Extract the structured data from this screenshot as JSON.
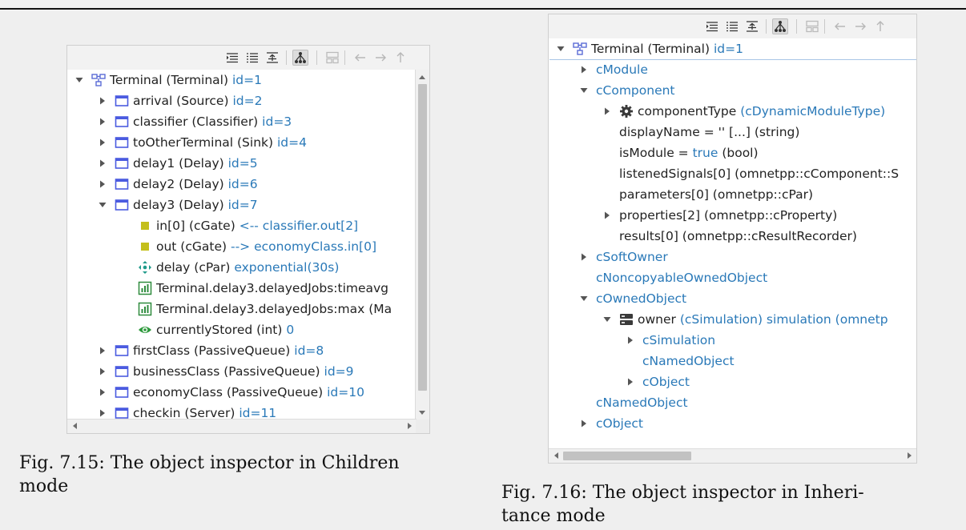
{
  "left": {
    "rows": [
      {
        "label": "Terminal (Terminal)",
        "extra": "id=1",
        "twisty": "open",
        "icon": "module-tree-icon",
        "depth": 0
      },
      {
        "label": "arrival (Source)",
        "extra": "id=2",
        "twisty": "closed",
        "icon": "module-icon",
        "depth": 1
      },
      {
        "label": "classifier (Classifier)",
        "extra": "id=3",
        "twisty": "closed",
        "icon": "module-icon",
        "depth": 1
      },
      {
        "label": "toOtherTerminal (Sink)",
        "extra": "id=4",
        "twisty": "closed",
        "icon": "module-icon",
        "depth": 1
      },
      {
        "label": "delay1 (Delay)",
        "extra": "id=5",
        "twisty": "closed",
        "icon": "module-icon",
        "depth": 1
      },
      {
        "label": "delay2 (Delay)",
        "extra": "id=6",
        "twisty": "closed",
        "icon": "module-icon",
        "depth": 1
      },
      {
        "label": "delay3 (Delay)",
        "extra": "id=7",
        "twisty": "open",
        "icon": "module-icon",
        "depth": 1
      },
      {
        "label": "in[0] (cGate)",
        "extra": "<-- classifier.out[2]",
        "twisty": "none",
        "icon": "gate-icon",
        "depth": 2
      },
      {
        "label": "out (cGate)",
        "extra": "--> economyClass.in[0]",
        "twisty": "none",
        "icon": "gate-icon",
        "depth": 2
      },
      {
        "label": "delay (cPar)",
        "extra": "exponential(30s)",
        "twisty": "none",
        "icon": "parameter-icon",
        "depth": 2
      },
      {
        "label": "Terminal.delay3.delayedJobs:timeavg",
        "extra": "",
        "twisty": "none",
        "icon": "statistic-icon",
        "depth": 2
      },
      {
        "label": "Terminal.delay3.delayedJobs:max (Ma",
        "extra": "",
        "twisty": "none",
        "icon": "statistic-icon",
        "depth": 2
      },
      {
        "label": "currentlyStored (int)",
        "extra": "0",
        "twisty": "none",
        "icon": "watch-icon",
        "depth": 2
      },
      {
        "label": "firstClass (PassiveQueue)",
        "extra": "id=8",
        "twisty": "closed",
        "icon": "module-icon",
        "depth": 1
      },
      {
        "label": "businessClass (PassiveQueue)",
        "extra": "id=9",
        "twisty": "closed",
        "icon": "module-icon",
        "depth": 1
      },
      {
        "label": "economyClass (PassiveQueue)",
        "extra": "id=10",
        "twisty": "closed",
        "icon": "module-icon",
        "depth": 1
      },
      {
        "label": "checkin (Server)",
        "extra": "id=11",
        "twisty": "closed",
        "icon": "module-icon",
        "depth": 1
      }
    ],
    "caption_lines": [
      "Fig. 7.15: The object inspector in Children",
      "mode"
    ]
  },
  "right": {
    "rows": [
      {
        "parts": [
          {
            "t": "Terminal (Terminal) ",
            "c": "k"
          },
          {
            "t": "id=1",
            "c": "b"
          }
        ],
        "twisty": "open",
        "icon": "module-tree-icon",
        "depth": 0
      },
      {
        "parts": [
          {
            "t": "cModule",
            "c": "b"
          }
        ],
        "twisty": "closed",
        "icon": "",
        "depth": 1
      },
      {
        "parts": [
          {
            "t": "cComponent",
            "c": "b"
          }
        ],
        "twisty": "open",
        "icon": "",
        "depth": 1
      },
      {
        "parts": [
          {
            "t": "componentType ",
            "c": "k"
          },
          {
            "t": "(cDynamicModuleType)",
            "c": "b"
          }
        ],
        "twisty": "closed",
        "icon": "gear-icon",
        "depth": 2
      },
      {
        "parts": [
          {
            "t": "displayName = '' [...]  (string)",
            "c": "k"
          }
        ],
        "twisty": "none",
        "icon": "",
        "depth": 2
      },
      {
        "parts": [
          {
            "t": "isModule = ",
            "c": "k"
          },
          {
            "t": "true",
            "c": "b"
          },
          {
            "t": " (bool)",
            "c": "k"
          }
        ],
        "twisty": "none",
        "icon": "",
        "depth": 2
      },
      {
        "parts": [
          {
            "t": "listenedSignals[0] (omnetpp::cComponent::S",
            "c": "k"
          }
        ],
        "twisty": "none",
        "icon": "",
        "depth": 2
      },
      {
        "parts": [
          {
            "t": "parameters[0] (omnetpp::cPar)",
            "c": "k"
          }
        ],
        "twisty": "none",
        "icon": "",
        "depth": 2
      },
      {
        "parts": [
          {
            "t": "properties[2] (omnetpp::cProperty)",
            "c": "k"
          }
        ],
        "twisty": "closed",
        "icon": "",
        "depth": 2
      },
      {
        "parts": [
          {
            "t": "results[0] (omnetpp::cResultRecorder)",
            "c": "k"
          }
        ],
        "twisty": "none",
        "icon": "",
        "depth": 2
      },
      {
        "parts": [
          {
            "t": "cSoftOwner",
            "c": "b"
          }
        ],
        "twisty": "closed",
        "icon": "",
        "depth": 1
      },
      {
        "parts": [
          {
            "t": "cNoncopyableOwnedObject",
            "c": "b"
          }
        ],
        "twisty": "none",
        "icon": "",
        "depth": 1
      },
      {
        "parts": [
          {
            "t": "cOwnedObject",
            "c": "b"
          }
        ],
        "twisty": "open",
        "icon": "",
        "depth": 1
      },
      {
        "parts": [
          {
            "t": "owner ",
            "c": "k"
          },
          {
            "t": "(cSimulation) simulation (omnetp",
            "c": "b"
          }
        ],
        "twisty": "open",
        "icon": "simulation-icon",
        "depth": 2
      },
      {
        "parts": [
          {
            "t": "cSimulation",
            "c": "b"
          }
        ],
        "twisty": "closed",
        "icon": "",
        "depth": 3
      },
      {
        "parts": [
          {
            "t": "cNamedObject",
            "c": "b"
          }
        ],
        "twisty": "none",
        "icon": "",
        "depth": 3
      },
      {
        "parts": [
          {
            "t": "cObject",
            "c": "b"
          }
        ],
        "twisty": "closed",
        "icon": "",
        "depth": 3
      },
      {
        "parts": [
          {
            "t": "cNamedObject",
            "c": "b"
          }
        ],
        "twisty": "none",
        "icon": "",
        "depth": 1
      },
      {
        "parts": [
          {
            "t": "cObject",
            "c": "b"
          }
        ],
        "twisty": "closed",
        "icon": "",
        "depth": 1
      }
    ],
    "caption_lines": [
      "Fig. 7.16: The object inspector in Inheri-",
      "tance mode"
    ]
  },
  "toolbar": [
    "tree-expand-icon",
    "list-icon",
    "flatten-icon",
    "hierarchy-icon",
    "layout-icon",
    "back-arrow-icon",
    "forward-arrow-icon",
    "up-arrow-icon"
  ]
}
